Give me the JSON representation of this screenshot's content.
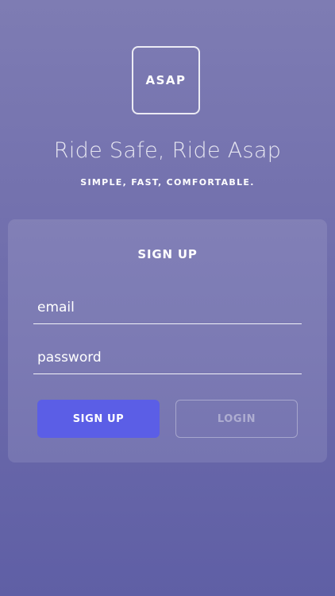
{
  "brand": {
    "logo_text": "ASAP",
    "tagline": "Ride Safe, Ride Asap",
    "subtagline": "SIMPLE, FAST, COMFORTABLE."
  },
  "form": {
    "title": "SIGN UP",
    "email": {
      "value": "",
      "placeholder": "email"
    },
    "password": {
      "value": "",
      "placeholder": "password"
    },
    "signup_label": "SIGN UP",
    "login_label": "LOGIN"
  },
  "colors": {
    "background_top": "#7e7cb3",
    "background_bottom": "#5f5fa5",
    "primary_button": "#5b5ee6"
  }
}
